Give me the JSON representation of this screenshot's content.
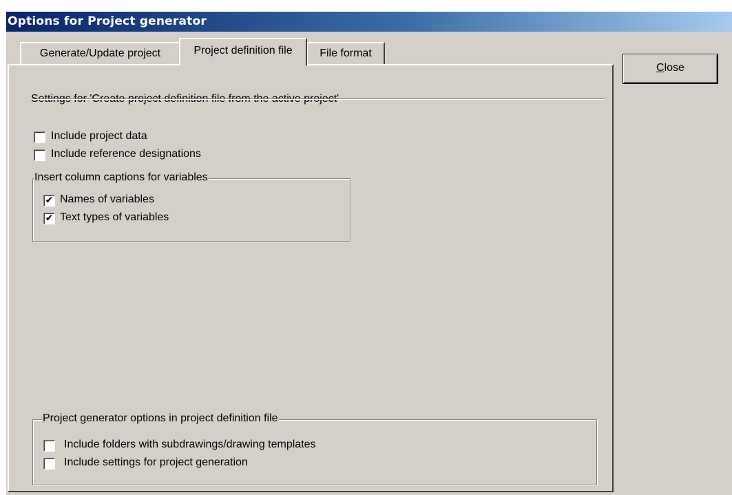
{
  "window": {
    "title": "Options for Project generator"
  },
  "tabs": [
    {
      "label": "Generate/Update project",
      "active": false
    },
    {
      "label": "Project definition file",
      "active": true
    },
    {
      "label": "File format",
      "active": false
    }
  ],
  "close_button": {
    "mnemonic": "C",
    "rest": "lose"
  },
  "panel": {
    "heading": "Settings for 'Create project definition file from the active project'",
    "include_project_data": {
      "label": "Include project data",
      "checked": false
    },
    "include_reference_designations": {
      "label": "Include reference designations",
      "checked": false
    },
    "captions_group": {
      "legend": "Insert column captions for variables",
      "names_of_variables": {
        "label": "Names of variables",
        "checked": true
      },
      "text_types_of_variables": {
        "label": "Text types of variables",
        "checked": true
      }
    },
    "generator_group": {
      "legend": "Project generator options in project definition file",
      "include_folders": {
        "label": "Include folders with subdrawings/drawing templates",
        "checked": false
      },
      "include_settings": {
        "label": "Include settings for project generation",
        "checked": false
      }
    }
  },
  "check_glyph": "✔"
}
